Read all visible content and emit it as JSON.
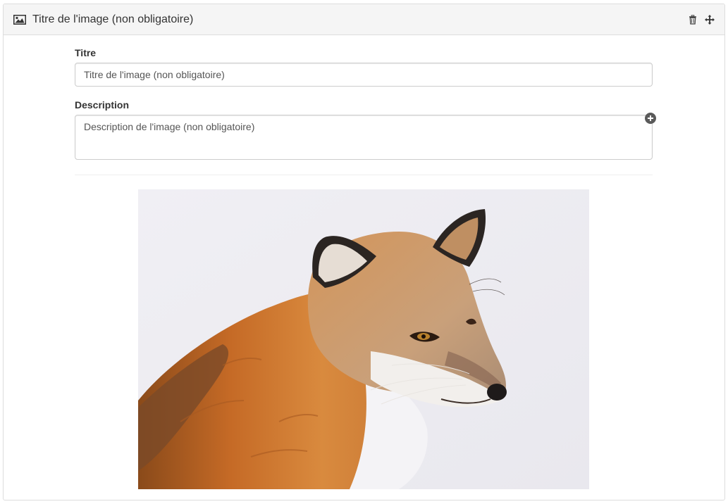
{
  "header": {
    "title": "Titre de l'image (non obligatoire)",
    "image_icon": "image-icon",
    "delete_icon": "trash-icon",
    "move_icon": "move-icon"
  },
  "form": {
    "title_label": "Titre",
    "title_value": "Titre de l'image (non obligatoire)",
    "description_label": "Description",
    "description_value": "Description de l'image (non obligatoire)",
    "add_icon": "plus-circle-icon"
  },
  "image": {
    "subject": "red fox"
  },
  "colors": {
    "header_bg": "#f5f5f5",
    "border": "#dddddd",
    "photo_bg": "#eeedf2",
    "fur": "#c96a24"
  }
}
